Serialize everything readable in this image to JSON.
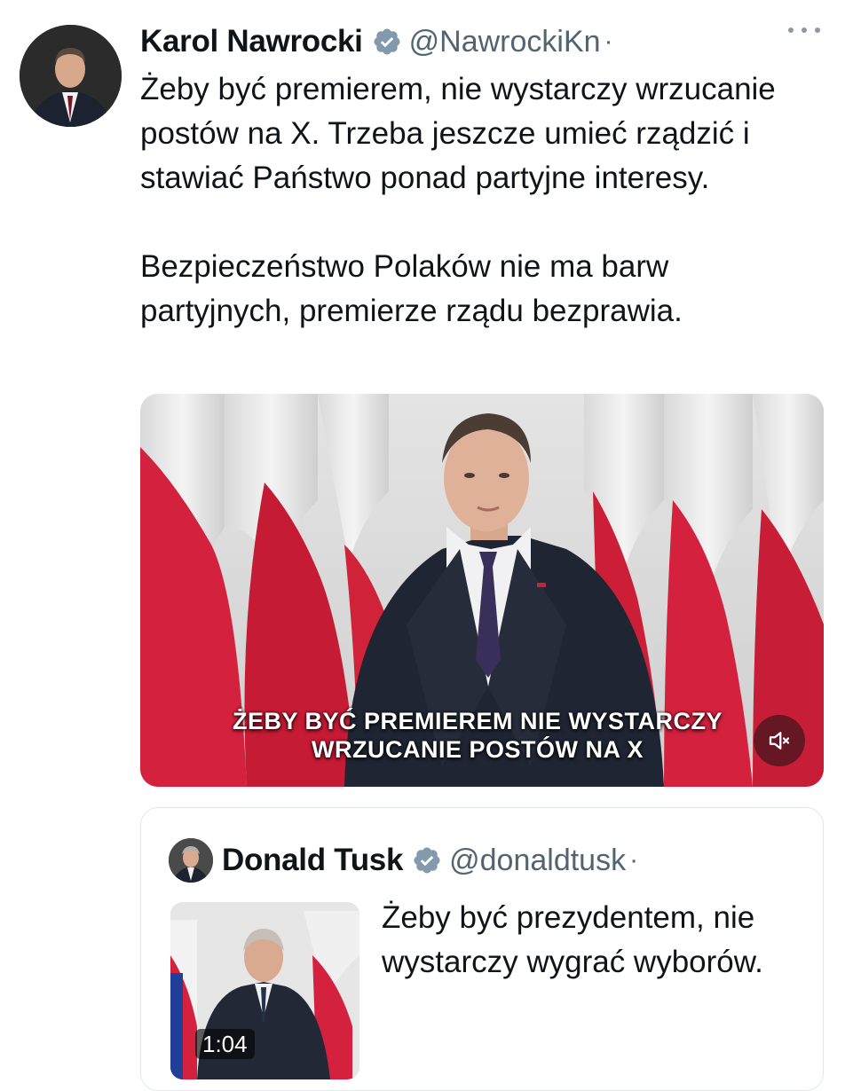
{
  "tweet": {
    "author_name": "Karol Nawrocki",
    "author_handle": "@NawrockiKn",
    "separator": "·",
    "verified_icon": "verified-badge-icon",
    "more_icon": "more-options-icon",
    "paragraphs": [
      "Żeby być premierem, nie wystarczy wrzucanie postów na X. Trzeba jeszcze umieć rządzić i stawiać Państwo ponad partyjne interesy.",
      "Bezpieczeństwo Polaków nie ma barw partyjnych, premierze rządu bezprawia."
    ],
    "video": {
      "caption_line1": "ŻEBY BYĆ PREMIEREM NIE WYSTARCZY",
      "caption_line2": "WRZUCANIE POSTÓW NA X",
      "mute_icon": "volume-muted-icon"
    }
  },
  "quoted_tweet": {
    "author_name": "Donald Tusk",
    "author_handle": "@donaldtusk",
    "separator": "·",
    "text": "Żeby być prezydentem, nie wystarczy wygrać wyborów.",
    "video_duration": "1:04"
  },
  "colors": {
    "text_primary": "#0f1419",
    "text_secondary": "#536471",
    "verified": "#829aab",
    "flag_red": "#d4213d"
  }
}
